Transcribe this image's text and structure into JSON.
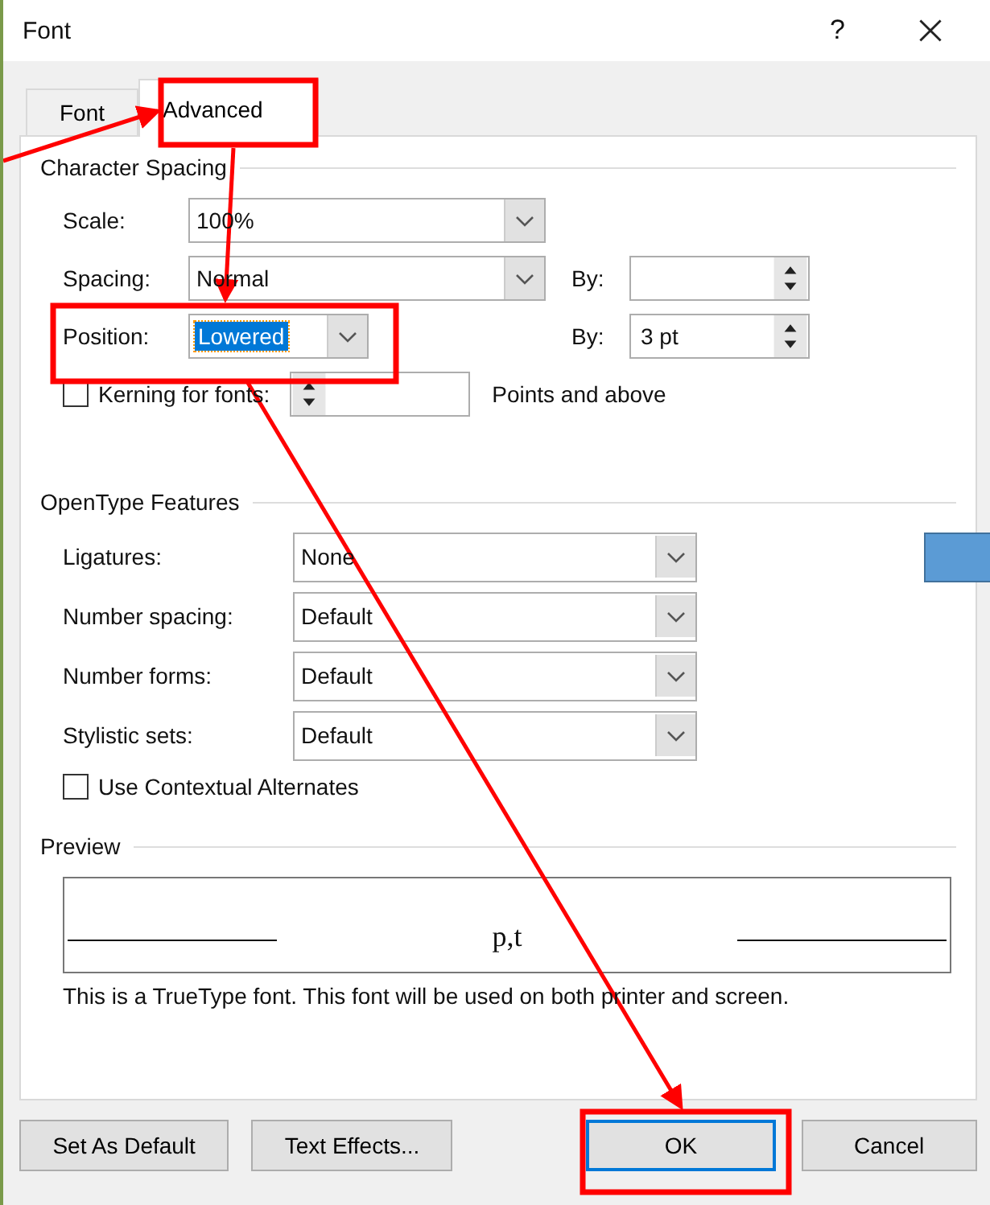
{
  "window": {
    "title": "Font",
    "help": "?"
  },
  "tabs": [
    {
      "label": "Font",
      "selected": false
    },
    {
      "label": "Advanced",
      "selected": true
    }
  ],
  "character_spacing": {
    "title": "Character Spacing",
    "rows": [
      {
        "kind": "combo",
        "label": "Scale:",
        "value": "100%",
        "value_selected": false
      },
      {
        "kind": "combo",
        "label": "Spacing:",
        "value": "Normal",
        "value_selected": false,
        "by": {
          "label": "By:"
        }
      },
      {
        "kind": "short-combo",
        "label": "Position:",
        "value": "Lowered",
        "value_selected": true,
        "by": {
          "label": "By:",
          "value": "3 pt"
        }
      },
      {
        "kind": "check",
        "label": "Kerning for fonts:",
        "checked": false,
        "suffix": "Points and above"
      }
    ]
  },
  "opentype": {
    "title": "OpenType Features",
    "rows": [
      {
        "label": "Ligatures:",
        "value": "None"
      },
      {
        "label": "Number spacing:",
        "value": "Default"
      },
      {
        "label": "Number forms:",
        "value": "Default"
      },
      {
        "label": "Stylistic sets:",
        "value": "Default"
      }
    ],
    "contextual": {
      "label": "Use Contextual Alternates",
      "checked": false
    }
  },
  "preview": {
    "title": "Preview",
    "sample": "p,t",
    "note": "This is a TrueType font. This font will be used on both printer and screen."
  },
  "buttons": [
    {
      "label": "Set As Default",
      "default": false
    },
    {
      "label": "Text Effects...",
      "default": false
    },
    {
      "label": "OK",
      "default": true
    },
    {
      "label": "Cancel",
      "default": false
    }
  ]
}
